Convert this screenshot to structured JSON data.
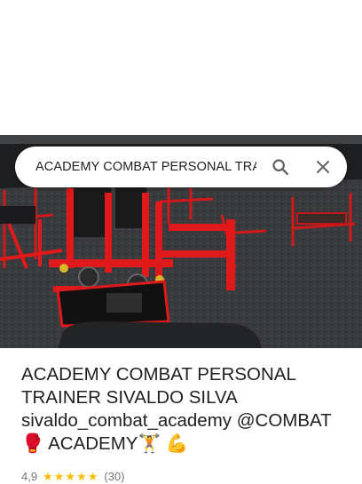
{
  "search": {
    "query": "ACADEMY COMBAT PERSONAL TRAINER SIVALDO SILVA"
  },
  "place": {
    "title": "ACADEMY COMBAT PERSONAL TRAINER SIVALDO SILVA sivaldo_combat_academy @COMBAT 🥊 ACADEMY🏋 💪",
    "rating": "4,9",
    "stars": 5,
    "review_count": "(30)"
  },
  "icons": {
    "search": "search-icon",
    "close": "close-icon",
    "star": "star-icon"
  },
  "colors": {
    "star": "#fbbc04",
    "equipment": "#e0191a"
  }
}
